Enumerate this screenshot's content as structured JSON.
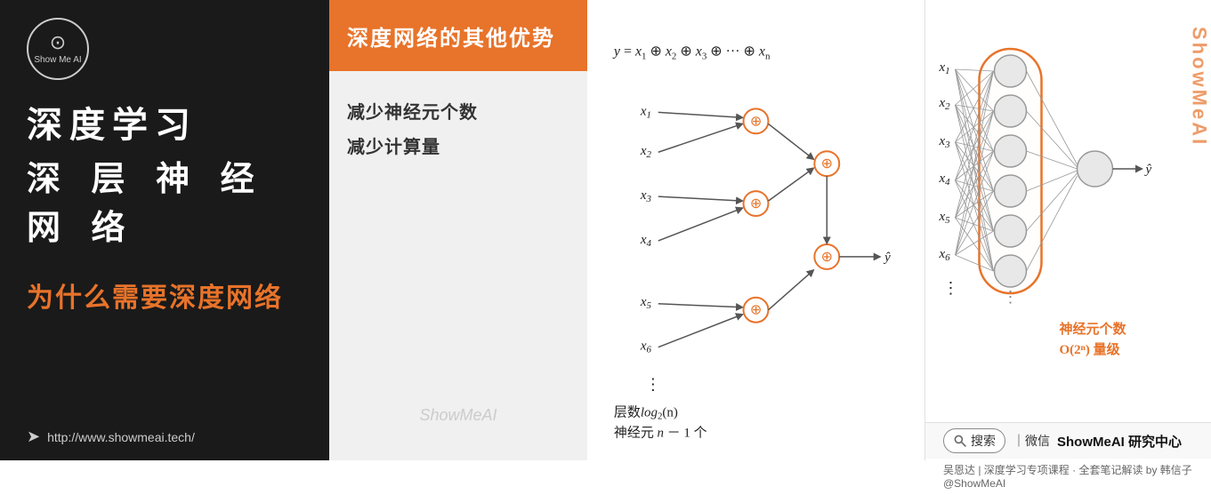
{
  "left": {
    "logo_alt": "ShowMeAI Logo",
    "logo_text": "Show Me AI",
    "title1": "深度学习",
    "title2": "深 层 神 经 网 络",
    "subtitle": "为什么需要深度网络",
    "link_text": "http://www.showmeai.tech/"
  },
  "middle": {
    "header": "深度网络的其他优势",
    "bullet1": "减少神经元个数",
    "bullet2": "减少计算量",
    "watermark": "ShowMeAI"
  },
  "diagram": {
    "formula": "y = x₁ ⊕ x₂ ⊕ x₃ ⊕ ··· ⊕ xₙ",
    "layers_label": "层数log₂(n)",
    "neurons_label": "神经元 n－1 个"
  },
  "nn": {
    "inputs": [
      "x₁",
      "x₂",
      "x₃",
      "x₄",
      "x₅",
      "x₆",
      "⋮"
    ],
    "neuron_count_label": "神经元个数",
    "neuron_count_order": "O(2ⁿ) 量级",
    "output_label": "ŷ",
    "watermark": "ShowMeAI"
  },
  "footer": {
    "search_label": "搜索",
    "separator": "｜微信",
    "brand": "ShowMeAI 研究中心",
    "credit": "吴恩达 | 深度学习专项课程 · 全套笔记解读 by 韩信子@ShowMeAI"
  }
}
